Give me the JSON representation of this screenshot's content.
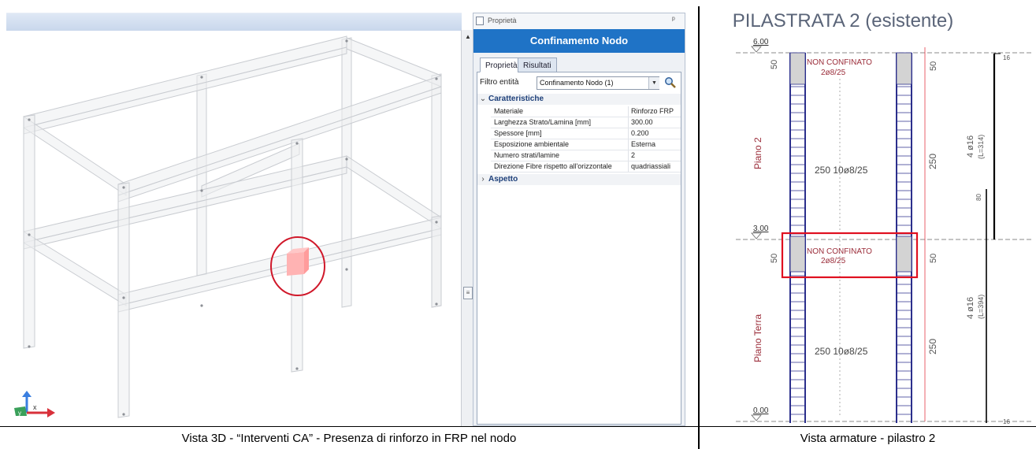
{
  "viewport": {
    "axis_labels": {
      "x": "x",
      "y": "y"
    }
  },
  "properties_panel": {
    "window_title": "Proprietà",
    "header": "Confinamento Nodo",
    "tabs": [
      {
        "label": "Proprietà"
      },
      {
        "label": "Risultati"
      }
    ],
    "filter": {
      "label": "Filtro entità",
      "value": "Confinamento Nodo (1)"
    },
    "sections": [
      {
        "label": "Caratteristiche",
        "expanded": true,
        "rows": [
          {
            "key": "Materiale",
            "value": "Rinforzo FRP"
          },
          {
            "key": "Larghezza Strato/Lamina  [mm]",
            "value": "300.00"
          },
          {
            "key": "Spessore  [mm]",
            "value": "0.200"
          },
          {
            "key": "Esposizione ambientale",
            "value": "Esterna"
          },
          {
            "key": "Numero strati/lamine",
            "value": "2"
          },
          {
            "key": "Direzione Fibre rispetto all'orizzontale",
            "value": "quadriassiali"
          }
        ]
      },
      {
        "label": "Aspetto",
        "expanded": false
      }
    ],
    "colors": {
      "header_bg": "#1f73c6",
      "section_text": "#1d3f79"
    }
  },
  "drawing": {
    "title": "PILASTRATA 2 (esistente)",
    "levels": [
      "6.00",
      "3.00",
      "0.00"
    ],
    "floors": [
      "Piano 2",
      "Piano Terra"
    ],
    "zones": [
      {
        "label": "NON CONFINATO",
        "sub": "2ø8/25",
        "dim": "50"
      },
      {
        "label": "NON CONFINATO",
        "sub": "2ø8/25",
        "dim": "50"
      }
    ],
    "stirrups": [
      "250  10ø8/25",
      "250  10ø8/25"
    ],
    "dims": [
      "250",
      "250"
    ],
    "bars": [
      {
        "label": "4 ø16",
        "length": "(L=314)",
        "top": "16",
        "mid": "80"
      },
      {
        "label": "4 ø16",
        "length": "(L=394)",
        "bottom": "16"
      }
    ],
    "colors": {
      "confinement_box": "#e01020",
      "text_red": "#9b2d3a",
      "column_outline": "#2b2f8c"
    }
  },
  "captions": {
    "left": "Vista 3D - “Interventi CA” - Presenza di rinforzo in FRP nel nodo",
    "right": "Vista armature - pilastro 2"
  }
}
